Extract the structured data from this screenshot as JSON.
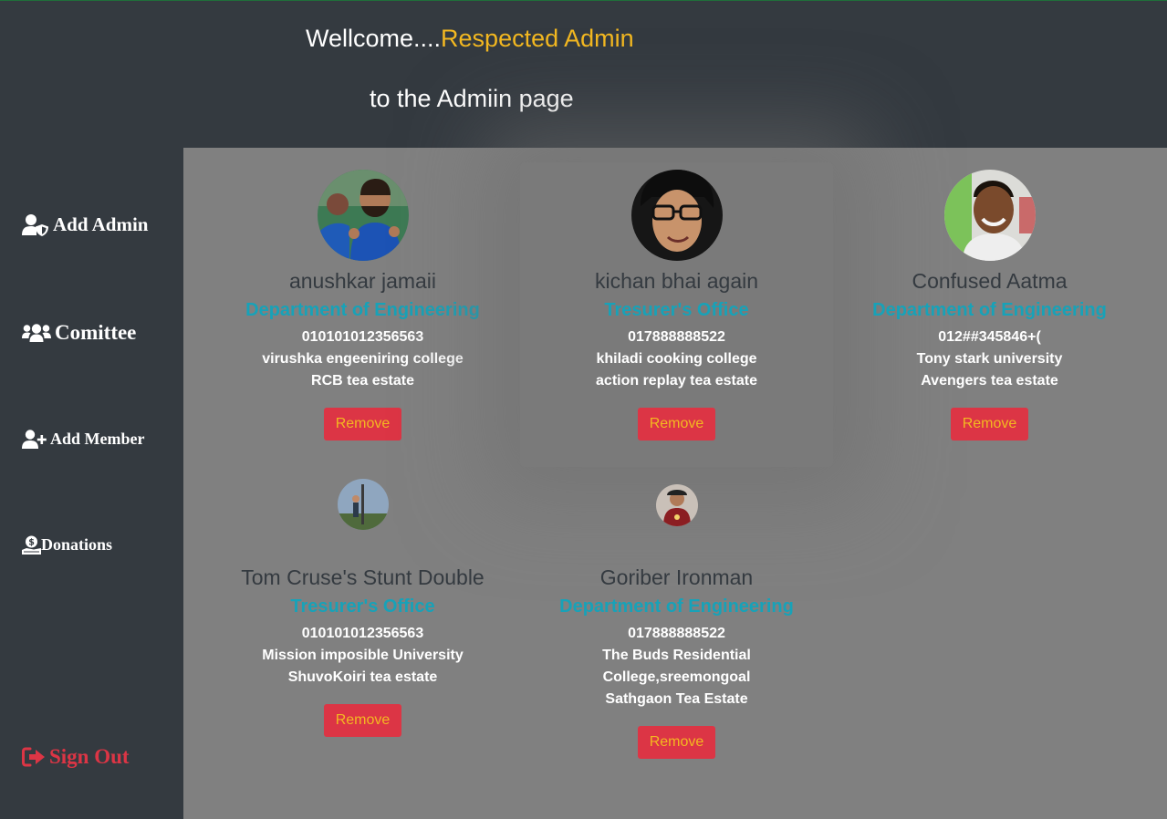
{
  "header": {
    "welcome_prefix": "Wellcome....",
    "welcome_accent": "Respected Admin",
    "subtitle": "to the Admiin page"
  },
  "colors": {
    "accent": "#f3b821",
    "danger": "#dc3545",
    "department": "#17a2b8",
    "dark": "#343a40",
    "content_bg": "#808080"
  },
  "sidebar": {
    "items": [
      {
        "label": "Add Admin",
        "icon": "user-shield-icon"
      },
      {
        "label": "Comittee",
        "icon": "users-icon"
      },
      {
        "label": "Add Member",
        "icon": "user-plus-icon"
      },
      {
        "label": "Donations",
        "icon": "hand-holding-dollar-icon"
      }
    ],
    "signout": {
      "label": "Sign Out",
      "icon": "sign-out-icon"
    }
  },
  "members": [
    {
      "name": "anushkar jamaii",
      "department": "Department of Engineering",
      "phone": "010101012356563",
      "lines": [
        "virushka engeeniring college",
        "RCB tea estate"
      ],
      "action": "Remove"
    },
    {
      "name": "kichan bhai again",
      "department": "Tresurer's Office",
      "phone": "017888888522",
      "lines": [
        "khiladi cooking college",
        "action replay tea estate"
      ],
      "action": "Remove"
    },
    {
      "name": "Confused Aatma",
      "department": "Department of Engineering",
      "phone": "012##345846+(",
      "lines": [
        "Tony stark university",
        "Avengers tea estate"
      ],
      "action": "Remove"
    },
    {
      "name": "Tom Cruse's Stunt Double",
      "department": "Tresurer's Office",
      "phone": "010101012356563",
      "lines": [
        "Mission imposible University",
        "ShuvoKoiri tea estate"
      ],
      "action": "Remove"
    },
    {
      "name": "Goriber Ironman",
      "department": "Department of Engineering",
      "phone": "017888888522",
      "lines": [
        "The Buds Residential",
        "College,sreemongoal",
        "Sathgaon Tea Estate"
      ],
      "action": "Remove"
    }
  ]
}
